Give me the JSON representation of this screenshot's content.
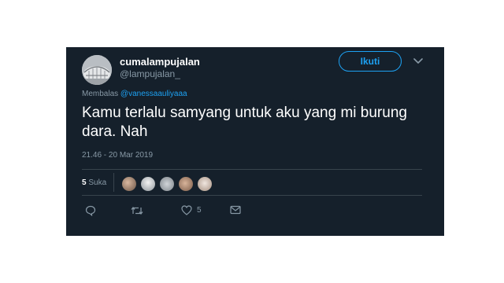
{
  "author": {
    "name": "cumalampujalan",
    "handle": "@lampujalan_",
    "avatar_icon": "avatar-image"
  },
  "follow_button_label": "Ikuti",
  "menu_icon": "chevron-down-icon",
  "reply": {
    "prefix": "Membalas",
    "mention": "@vanessaauliyaaa"
  },
  "tweet_text": "Kamu terlalu samyang untuk aku yang mi burung dara. Nah",
  "timestamp": "21.46 - 20 Mar 2019",
  "likes": {
    "count": "5",
    "label": "Suka",
    "liker_avatars": [
      "liker-avatar-1",
      "liker-avatar-2",
      "liker-avatar-3",
      "liker-avatar-4",
      "liker-avatar-5"
    ]
  },
  "actions": {
    "reply_icon": "reply-icon",
    "retweet_icon": "retweet-icon",
    "like_icon": "heart-icon",
    "like_count": "5",
    "message_icon": "mail-icon"
  },
  "colors": {
    "background": "#15202b",
    "accent": "#1da1f2",
    "muted": "#8899a6",
    "divider": "#38444d"
  }
}
